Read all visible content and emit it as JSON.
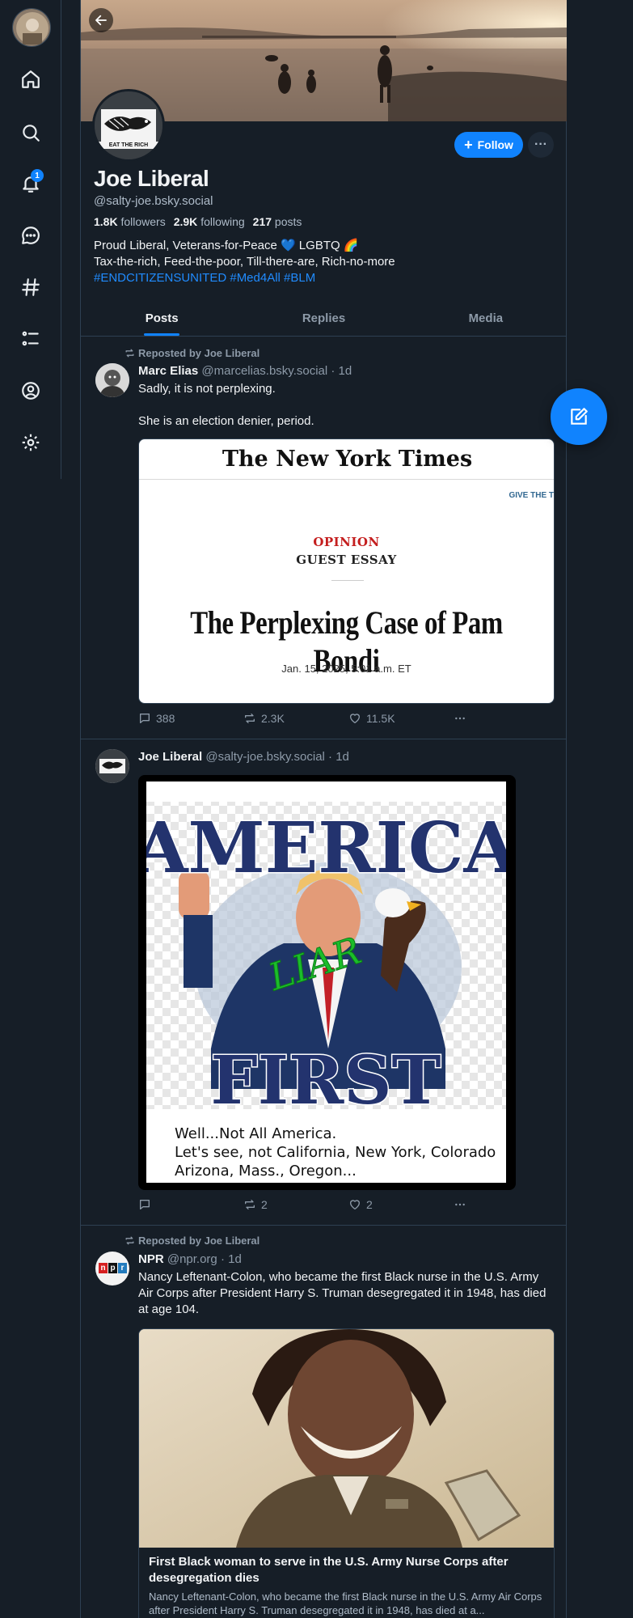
{
  "nav": {
    "notifications_badge": "1",
    "icons": [
      "home-icon",
      "search-icon",
      "bell-icon",
      "chat-icon",
      "hashtag-icon",
      "list-icon",
      "profile-icon",
      "gear-icon"
    ]
  },
  "profile": {
    "display_name": "Joe Liberal",
    "handle": "@salty-joe.bsky.social",
    "followers_count": "1.8K",
    "followers_label": "followers",
    "following_count": "2.9K",
    "following_label": "following",
    "posts_count": "217",
    "posts_label": "posts",
    "follow_label": "Follow",
    "more_label": "···",
    "avatar_text": "EAT THE RICH",
    "bio_line1": "Proud Liberal, Veterans-for-Peace 💙 LGBTQ 🌈",
    "bio_line2": "Tax-the-rich, Feed-the-poor, Till-there-are, Rich-no-more",
    "bio_tags": "#ENDCITIZENSUNITED #Med4All #BLM"
  },
  "tabs": [
    {
      "label": "Posts",
      "active": true
    },
    {
      "label": "Replies",
      "active": false
    },
    {
      "label": "Media",
      "active": false
    }
  ],
  "posts": [
    {
      "repost_label": "Reposted by Joe Liberal",
      "author": "Marc Elias",
      "handle": "@marcelias.bsky.social",
      "time": "· 1d",
      "text": "Sadly, it is not perplexing.\n\nShe is an election denier, period.",
      "embed": {
        "masthead": "The New York Times",
        "give": "GIVE THE T",
        "section": "OPINION",
        "subsection": "GUEST ESSAY",
        "headline": "The Perplexing Case of Pam Bondi",
        "date": "Jan. 15, 2025, 5:01 a.m. ET"
      },
      "replies": "388",
      "reposts": "2.3K",
      "likes": "11.5K"
    },
    {
      "author": "Joe Liberal",
      "handle": "@salty-joe.bsky.social",
      "time": "· 1d",
      "image_text": {
        "top": "AMERICA",
        "bottom": "FIRST",
        "stamp": "LIAR",
        "caption_line1": "Well...Not All America.",
        "caption_line2": "Let's see, not California, New York, Colorado",
        "caption_line3": "Arizona, Mass., Oregon..."
      },
      "replies": "",
      "reposts": "2",
      "likes": "2"
    },
    {
      "repost_label": "Reposted by Joe Liberal",
      "author": "NPR",
      "handle": "@npr.org",
      "time": "· 1d",
      "avatar_text": "npr",
      "text": "Nancy Leftenant-Colon, who became the first Black nurse in the U.S. Army Air Corps after President Harry S. Truman desegregated it in 1948, has died at age 104.",
      "card": {
        "title": "First Black woman to serve in the U.S. Army Nurse Corps after desegregation dies",
        "description": "Nancy Leftenant-Colon, who became the first Black nurse in the U.S. Army Air Corps after President Harry S. Truman desegregated it in 1948, has died at a..."
      }
    }
  ],
  "colors": {
    "background": "#161e27",
    "accent": "#1083fe",
    "border": "#2e4052",
    "muted": "#8d9aa8"
  }
}
